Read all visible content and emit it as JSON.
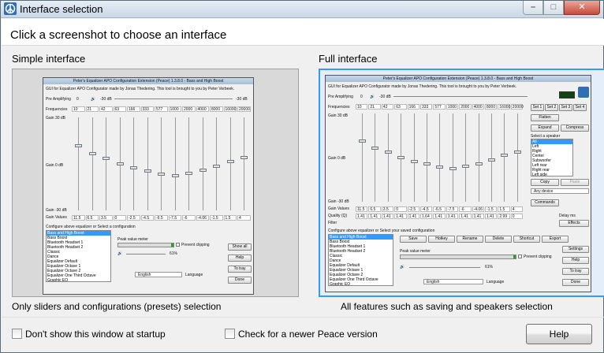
{
  "window": {
    "title": "Interface selection",
    "controls": {
      "minimize": "–",
      "maximize": "□",
      "close": "✕"
    }
  },
  "instruction": "Click a screenshot to choose an interface",
  "simple": {
    "heading": "Simple interface",
    "caption": "Only sliders and configurations (presets) selection",
    "preview": {
      "title": "Peter's Equalizer APO Configuration Extension (Peace) 1.3.8.0 - Bass and High Boost",
      "info": "GUI for Equalizer APO Configurator made by Jonas Thedering. This tool is brought to you by Peter Verbeek.",
      "pre_amp_label": "Pre Amplifying",
      "pre_amp_value": "0",
      "pre_amp_db": "-30 dB",
      "pre_amp_right": "-30 dB",
      "frequencies_label": "Frequencies",
      "frequencies": [
        "10",
        "21",
        "42",
        "63",
        "166",
        "333",
        "577",
        "1000",
        "2000",
        "4000",
        "8000",
        "16000",
        "20000"
      ],
      "gain_top": "Gain 30 dB",
      "gain_mid": "Gain 0 dB",
      "gain_bottom": "Gain -30 dB",
      "gain_values_label": "Gain Values",
      "gain_values": [
        "11.5",
        "6.5",
        "3.5",
        "0",
        "-2.5",
        "-4.5",
        "-6.5",
        "-7.5",
        "-6",
        "-4.06",
        "-1.5",
        "1.5",
        "4"
      ],
      "config_label": "Configure above equalizer or Select a configuration",
      "configs": [
        "Bass and High Boost",
        "Bass Boost",
        "Bluetooth Headset 1",
        "Bluetooth Headset 2",
        "Classic",
        "Dance",
        "Equalizer Default",
        "Equalizer Octave 1",
        "Equalizer Octave 2",
        "Equalizer One Third Octave",
        "Graphic EQ",
        "High Boost"
      ],
      "peak_label": "Peak value meter",
      "prevent_clipping": "Prevent clipping",
      "volume": "61%",
      "language_value": "English",
      "language_label": "Language",
      "buttons": [
        "Show all",
        "Help",
        "To tray",
        "Done"
      ]
    }
  },
  "full": {
    "heading": "Full interface",
    "caption": "All features such as saving and speakers selection",
    "preview": {
      "title": "Peter's Equalizer APO Configuration Extension (Peace) 1.3.8.0 - Bass and High Boost",
      "info": "GUI for Equalizer APO Configurator made by Jonas Thedering. This tool is brought to you by Peter Verbeek.",
      "pre_amp_label": "Pre Amplifying",
      "pre_amp_value": "0",
      "pre_amp_db": "-30 dB",
      "frequencies_label": "Frequencies",
      "frequencies": [
        "10",
        "21",
        "42",
        "63",
        "166",
        "333",
        "577",
        "1000",
        "2000",
        "4000",
        "8000",
        "16000",
        "20000"
      ],
      "set_buttons": [
        "Set 1",
        "Set 2",
        "Set 3",
        "Set 4"
      ],
      "side_buttons": [
        "Flatten",
        "Expand",
        "Compress"
      ],
      "speaker_label": "Select a speaker",
      "speakers": [
        "All",
        "Left",
        "Right",
        "Center",
        "Subwoofer",
        "Left rear",
        "Right rear",
        "Left side",
        "Right side"
      ],
      "copy": "Copy",
      "paste": "Paste",
      "device": "Any device",
      "commands": "Commands",
      "gain_top": "Gain 30 dB",
      "gain_mid": "Gain 0 dB",
      "gain_bottom": "Gain -30 dB",
      "gain_values_label": "Gain Values",
      "gain_values": [
        "11.5",
        "6.5",
        "3.5",
        "0",
        "-2.5",
        "-4.5",
        "-6.5",
        "-7.5",
        "-6",
        "-4.06",
        "-1.5",
        "1.5",
        "4"
      ],
      "quality_label": "Quality (Q)",
      "quality": [
        "1.41",
        "1.41",
        "1.41",
        "1.41",
        "1.41",
        "1.64",
        "1.41",
        "1.41",
        "1.41",
        "1.41",
        "1.41",
        "2.99",
        "0"
      ],
      "filter_label": "Filter",
      "delay": "Delay ms",
      "effects": "Effects",
      "config_label": "Configure above equalizer or Select your saved configuration",
      "configs": [
        "Bass and High Boost",
        "Bass Boost",
        "Bluetooth Headset 1",
        "Bluetooth Headset 2",
        "Classic",
        "Dance",
        "Equalizer Default",
        "Equalizer Octave 1",
        "Equalizer Octave 2",
        "Equalizer One Third Octave",
        "Graphic EQ",
        "High Boost"
      ],
      "save_buttons": [
        "Save",
        "Hotkey",
        "Rename",
        "Delete",
        "Shortcut",
        "Export"
      ],
      "peak_label": "Peak value meter",
      "prevent_clipping": "Prevent clipping",
      "volume": "61%",
      "language_value": "English",
      "language_label": "Language",
      "buttons": [
        "Settings",
        "Help",
        "To tray",
        "Done"
      ]
    }
  },
  "footer": {
    "startup_checkbox": "Don't show this window at startup",
    "update_checkbox": "Check for a newer Peace version",
    "help_button": "Help"
  },
  "colors": {
    "selection_border": "#3399ff",
    "close_button": "#c74a38"
  }
}
